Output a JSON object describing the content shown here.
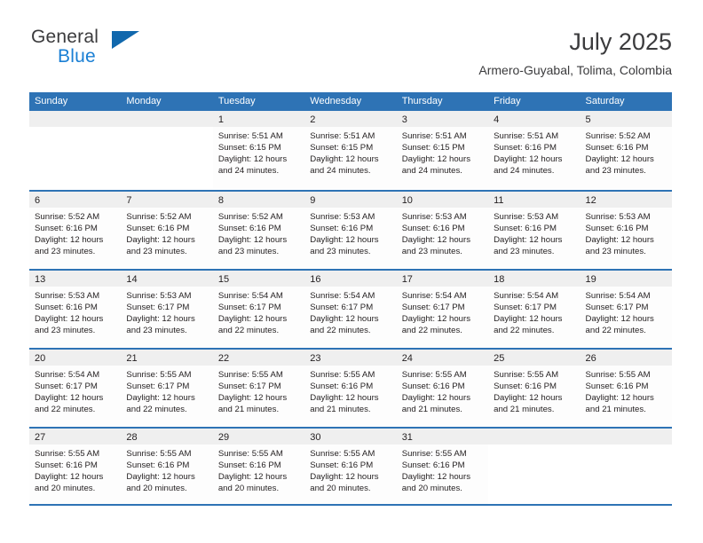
{
  "brand": {
    "word_one": "General",
    "word_two": "Blue",
    "triangle_icon": "triangle-icon",
    "colors": {
      "general_text": "#3b3b3d",
      "blue_text": "#1a7fd4",
      "triangle": "#1168ad"
    }
  },
  "header": {
    "title": "July 2025",
    "subtitle": "Armero-Guyabal, Tolima, Colombia"
  },
  "theme": {
    "header_blue": "#2e73b5",
    "day_band_gray": "#efefef",
    "text": "#231f20"
  },
  "weekdays": [
    "Sunday",
    "Monday",
    "Tuesday",
    "Wednesday",
    "Thursday",
    "Friday",
    "Saturday"
  ],
  "weeks": [
    [
      {
        "day": "",
        "lines": []
      },
      {
        "day": "",
        "lines": []
      },
      {
        "day": "1",
        "lines": [
          "Sunrise: 5:51 AM",
          "Sunset: 6:15 PM",
          "Daylight: 12 hours",
          "and 24 minutes."
        ]
      },
      {
        "day": "2",
        "lines": [
          "Sunrise: 5:51 AM",
          "Sunset: 6:15 PM",
          "Daylight: 12 hours",
          "and 24 minutes."
        ]
      },
      {
        "day": "3",
        "lines": [
          "Sunrise: 5:51 AM",
          "Sunset: 6:15 PM",
          "Daylight: 12 hours",
          "and 24 minutes."
        ]
      },
      {
        "day": "4",
        "lines": [
          "Sunrise: 5:51 AM",
          "Sunset: 6:16 PM",
          "Daylight: 12 hours",
          "and 24 minutes."
        ]
      },
      {
        "day": "5",
        "lines": [
          "Sunrise: 5:52 AM",
          "Sunset: 6:16 PM",
          "Daylight: 12 hours",
          "and 23 minutes."
        ]
      }
    ],
    [
      {
        "day": "6",
        "lines": [
          "Sunrise: 5:52 AM",
          "Sunset: 6:16 PM",
          "Daylight: 12 hours",
          "and 23 minutes."
        ]
      },
      {
        "day": "7",
        "lines": [
          "Sunrise: 5:52 AM",
          "Sunset: 6:16 PM",
          "Daylight: 12 hours",
          "and 23 minutes."
        ]
      },
      {
        "day": "8",
        "lines": [
          "Sunrise: 5:52 AM",
          "Sunset: 6:16 PM",
          "Daylight: 12 hours",
          "and 23 minutes."
        ]
      },
      {
        "day": "9",
        "lines": [
          "Sunrise: 5:53 AM",
          "Sunset: 6:16 PM",
          "Daylight: 12 hours",
          "and 23 minutes."
        ]
      },
      {
        "day": "10",
        "lines": [
          "Sunrise: 5:53 AM",
          "Sunset: 6:16 PM",
          "Daylight: 12 hours",
          "and 23 minutes."
        ]
      },
      {
        "day": "11",
        "lines": [
          "Sunrise: 5:53 AM",
          "Sunset: 6:16 PM",
          "Daylight: 12 hours",
          "and 23 minutes."
        ]
      },
      {
        "day": "12",
        "lines": [
          "Sunrise: 5:53 AM",
          "Sunset: 6:16 PM",
          "Daylight: 12 hours",
          "and 23 minutes."
        ]
      }
    ],
    [
      {
        "day": "13",
        "lines": [
          "Sunrise: 5:53 AM",
          "Sunset: 6:16 PM",
          "Daylight: 12 hours",
          "and 23 minutes."
        ]
      },
      {
        "day": "14",
        "lines": [
          "Sunrise: 5:53 AM",
          "Sunset: 6:17 PM",
          "Daylight: 12 hours",
          "and 23 minutes."
        ]
      },
      {
        "day": "15",
        "lines": [
          "Sunrise: 5:54 AM",
          "Sunset: 6:17 PM",
          "Daylight: 12 hours",
          "and 22 minutes."
        ]
      },
      {
        "day": "16",
        "lines": [
          "Sunrise: 5:54 AM",
          "Sunset: 6:17 PM",
          "Daylight: 12 hours",
          "and 22 minutes."
        ]
      },
      {
        "day": "17",
        "lines": [
          "Sunrise: 5:54 AM",
          "Sunset: 6:17 PM",
          "Daylight: 12 hours",
          "and 22 minutes."
        ]
      },
      {
        "day": "18",
        "lines": [
          "Sunrise: 5:54 AM",
          "Sunset: 6:17 PM",
          "Daylight: 12 hours",
          "and 22 minutes."
        ]
      },
      {
        "day": "19",
        "lines": [
          "Sunrise: 5:54 AM",
          "Sunset: 6:17 PM",
          "Daylight: 12 hours",
          "and 22 minutes."
        ]
      }
    ],
    [
      {
        "day": "20",
        "lines": [
          "Sunrise: 5:54 AM",
          "Sunset: 6:17 PM",
          "Daylight: 12 hours",
          "and 22 minutes."
        ]
      },
      {
        "day": "21",
        "lines": [
          "Sunrise: 5:55 AM",
          "Sunset: 6:17 PM",
          "Daylight: 12 hours",
          "and 22 minutes."
        ]
      },
      {
        "day": "22",
        "lines": [
          "Sunrise: 5:55 AM",
          "Sunset: 6:17 PM",
          "Daylight: 12 hours",
          "and 21 minutes."
        ]
      },
      {
        "day": "23",
        "lines": [
          "Sunrise: 5:55 AM",
          "Sunset: 6:16 PM",
          "Daylight: 12 hours",
          "and 21 minutes."
        ]
      },
      {
        "day": "24",
        "lines": [
          "Sunrise: 5:55 AM",
          "Sunset: 6:16 PM",
          "Daylight: 12 hours",
          "and 21 minutes."
        ]
      },
      {
        "day": "25",
        "lines": [
          "Sunrise: 5:55 AM",
          "Sunset: 6:16 PM",
          "Daylight: 12 hours",
          "and 21 minutes."
        ]
      },
      {
        "day": "26",
        "lines": [
          "Sunrise: 5:55 AM",
          "Sunset: 6:16 PM",
          "Daylight: 12 hours",
          "and 21 minutes."
        ]
      }
    ],
    [
      {
        "day": "27",
        "lines": [
          "Sunrise: 5:55 AM",
          "Sunset: 6:16 PM",
          "Daylight: 12 hours",
          "and 20 minutes."
        ]
      },
      {
        "day": "28",
        "lines": [
          "Sunrise: 5:55 AM",
          "Sunset: 6:16 PM",
          "Daylight: 12 hours",
          "and 20 minutes."
        ]
      },
      {
        "day": "29",
        "lines": [
          "Sunrise: 5:55 AM",
          "Sunset: 6:16 PM",
          "Daylight: 12 hours",
          "and 20 minutes."
        ]
      },
      {
        "day": "30",
        "lines": [
          "Sunrise: 5:55 AM",
          "Sunset: 6:16 PM",
          "Daylight: 12 hours",
          "and 20 minutes."
        ]
      },
      {
        "day": "31",
        "lines": [
          "Sunrise: 5:55 AM",
          "Sunset: 6:16 PM",
          "Daylight: 12 hours",
          "and 20 minutes."
        ]
      },
      {
        "day": "",
        "lines": []
      },
      {
        "day": "",
        "lines": []
      }
    ]
  ]
}
